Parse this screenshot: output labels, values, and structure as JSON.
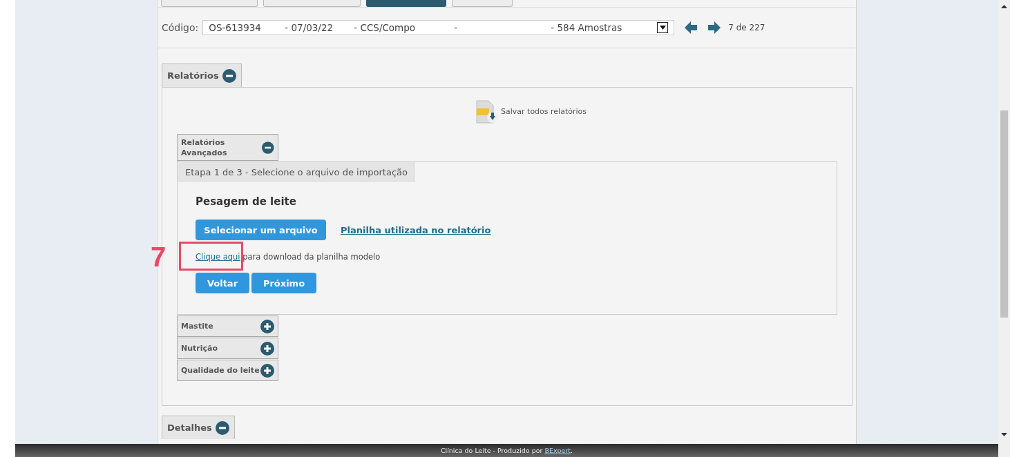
{
  "tabs": [
    {
      "selected": false
    },
    {
      "selected": false
    },
    {
      "selected": true
    },
    {
      "selected": false
    }
  ],
  "code_selector": {
    "label": "Código:",
    "value_parts": [
      "OS-613934",
      "- 07/03/22",
      "- CCS/Compo",
      "-",
      "- 584 Amostras"
    ],
    "pager": "7 de 227"
  },
  "reports": {
    "title": "Relatórios",
    "expanded": true,
    "save_all": "Salvar todos relatórios",
    "groups": [
      {
        "title": "Relatórios Avançados",
        "expanded": true,
        "step": "Etapa 1 de 3 - Selecione o arquivo de importação",
        "heading": "Pesagem de leite",
        "select_button": "Selecionar um arquivo",
        "sheet_link": "Planilha utilizada no relatório",
        "download_link": "Clique aqui",
        "download_text": " para download da planilha modelo",
        "buttons": [
          "Voltar",
          "Próximo"
        ]
      },
      {
        "title": "Mastite",
        "expanded": false
      },
      {
        "title": "Nutrição",
        "expanded": false
      },
      {
        "title": "Qualidade do leite",
        "expanded": false
      }
    ]
  },
  "details": {
    "title": "Detalhes",
    "expanded": true
  },
  "annotation": {
    "number": "7"
  },
  "footer": {
    "text": "Clínica do Leite - Produzido por ",
    "link": "BExpert",
    "end": "."
  }
}
